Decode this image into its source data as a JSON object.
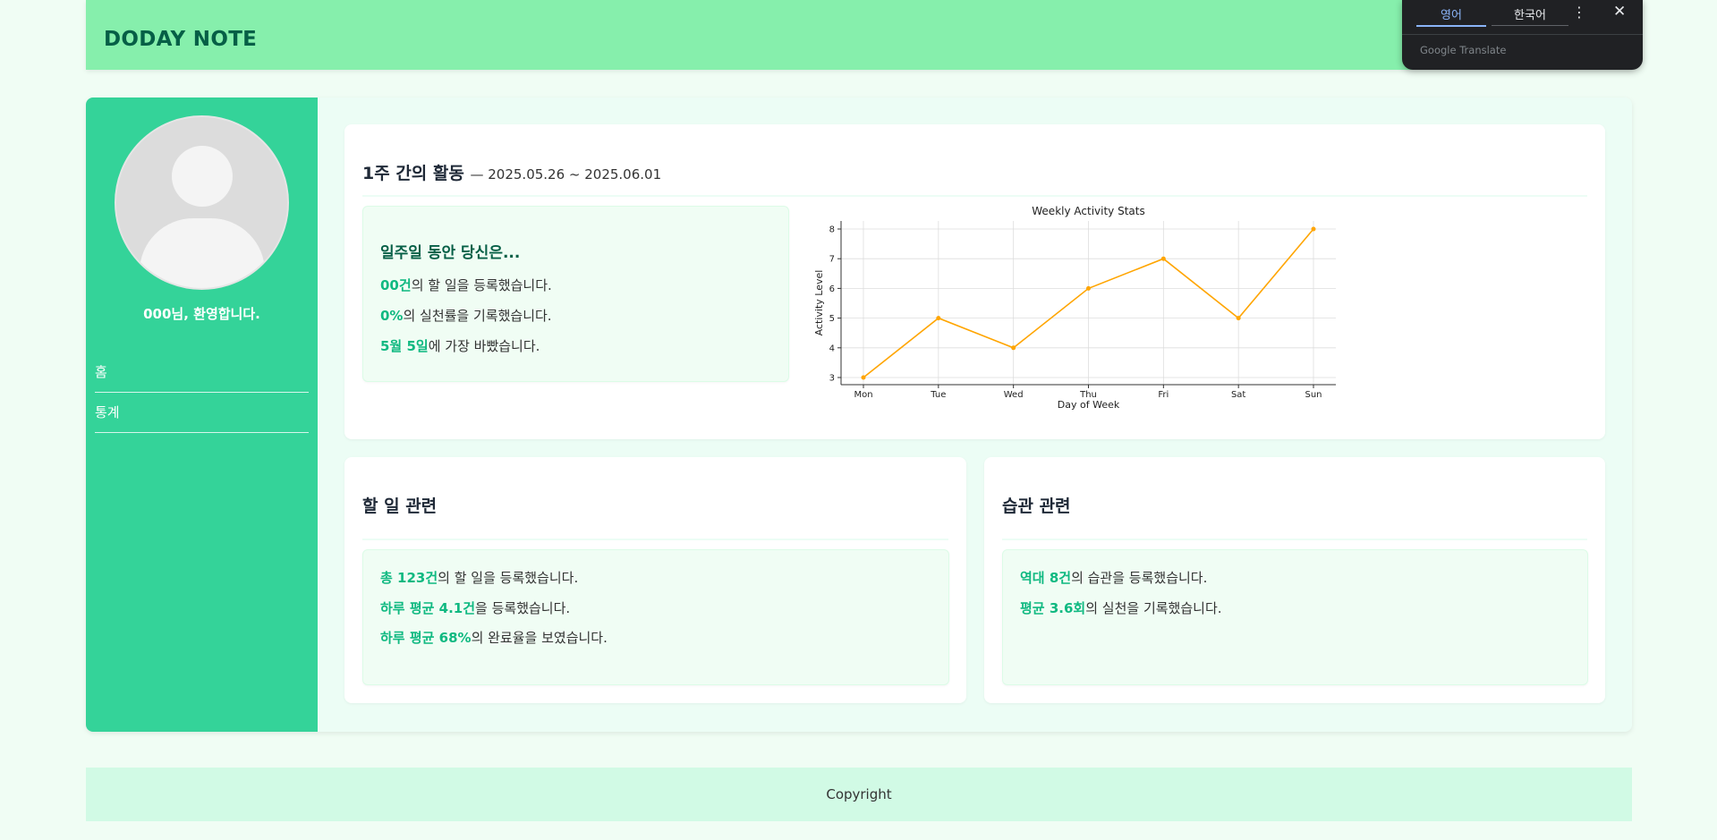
{
  "header": {
    "logo": "DODAY NOTE"
  },
  "translate_popup": {
    "tabs": [
      "영어",
      "한국어"
    ],
    "menu_icon": "more-vert-icon",
    "close_icon": "close-icon",
    "brand": "Google Translate"
  },
  "sidebar": {
    "welcome": "000님, 환영합니다.",
    "nav": [
      {
        "label": "홈"
      },
      {
        "label": "통계"
      }
    ]
  },
  "weekly": {
    "title": "1주 간의 활동",
    "range": "— 2025.05.26 ~ 2025.06.01",
    "summary_heading": "일주일 동안 당신은...",
    "lines": [
      {
        "hl": "00건",
        "rest": "의 할 일을 등록했습니다."
      },
      {
        "hl": "0%",
        "rest": "의 실천률을 기록했습니다."
      },
      {
        "hl": "5월 5일",
        "rest": "에 가장 바빴습니다."
      }
    ]
  },
  "chart_data": {
    "type": "line",
    "title": "Weekly Activity Stats",
    "xlabel": "Day of Week",
    "ylabel": "Activity Level",
    "categories": [
      "Mon",
      "Tue",
      "Wed",
      "Thu",
      "Fri",
      "Sat",
      "Sun"
    ],
    "values": [
      3,
      5,
      4,
      6,
      7,
      5,
      8
    ],
    "ylim": [
      3,
      8
    ],
    "yticks": [
      3,
      4,
      5,
      6,
      7,
      8
    ],
    "grid": true,
    "color": "#ffa500"
  },
  "todo": {
    "title": "할 일 관련",
    "lines": [
      {
        "hl": "총 123건",
        "rest": "의 할 일을 등록했습니다."
      },
      {
        "hl": "하루 평균 4.1건",
        "rest": "을 등록했습니다."
      },
      {
        "hl": "하루 평균 68%",
        "rest": "의 완료율을 보였습니다."
      }
    ]
  },
  "habit": {
    "title": "습관 관련",
    "lines": [
      {
        "hl": "역대 8건",
        "rest": "의 습관을 등록했습니다."
      },
      {
        "hl": "평균 3.6회",
        "rest": "의 실천을 기록했습니다."
      }
    ]
  },
  "footer": {
    "text": "Copyright"
  },
  "colors": {
    "header": "#86efac",
    "sidebar": "#34d399",
    "highlight": "#10b981",
    "accent_dark": "#065f46"
  }
}
